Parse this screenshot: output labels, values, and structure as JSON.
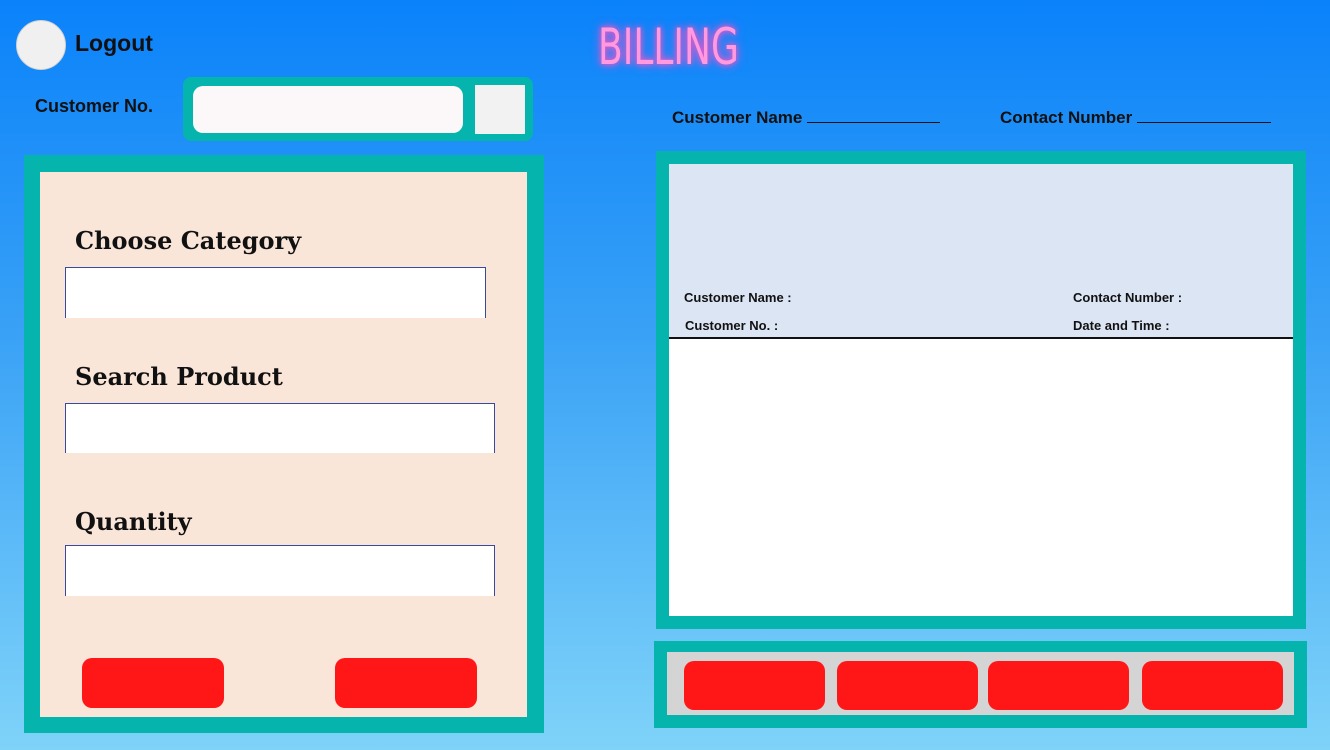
{
  "header": {
    "logout_label": "Logout",
    "title": "BILLING"
  },
  "customer_lookup": {
    "label": "Customer No.",
    "input_value": ""
  },
  "customer_info": {
    "name_label": "Customer Name",
    "contact_label": "Contact Number"
  },
  "form": {
    "category_label": "Choose Category",
    "category_value": "",
    "search_label": "Search Product",
    "search_value": "",
    "quantity_label": "Quantity",
    "quantity_value": ""
  },
  "bill": {
    "customer_name_label": "Customer Name :",
    "contact_number_label": "Contact Number :",
    "customer_no_label": "Customer No. :",
    "date_time_label": "Date and Time :"
  },
  "colors": {
    "teal_frame": "#04b4ad",
    "form_bg": "#fae5d9",
    "bill_header_bg": "#dce5f3",
    "action_button": "#ff1616",
    "title_neon": "#ff9adf"
  }
}
